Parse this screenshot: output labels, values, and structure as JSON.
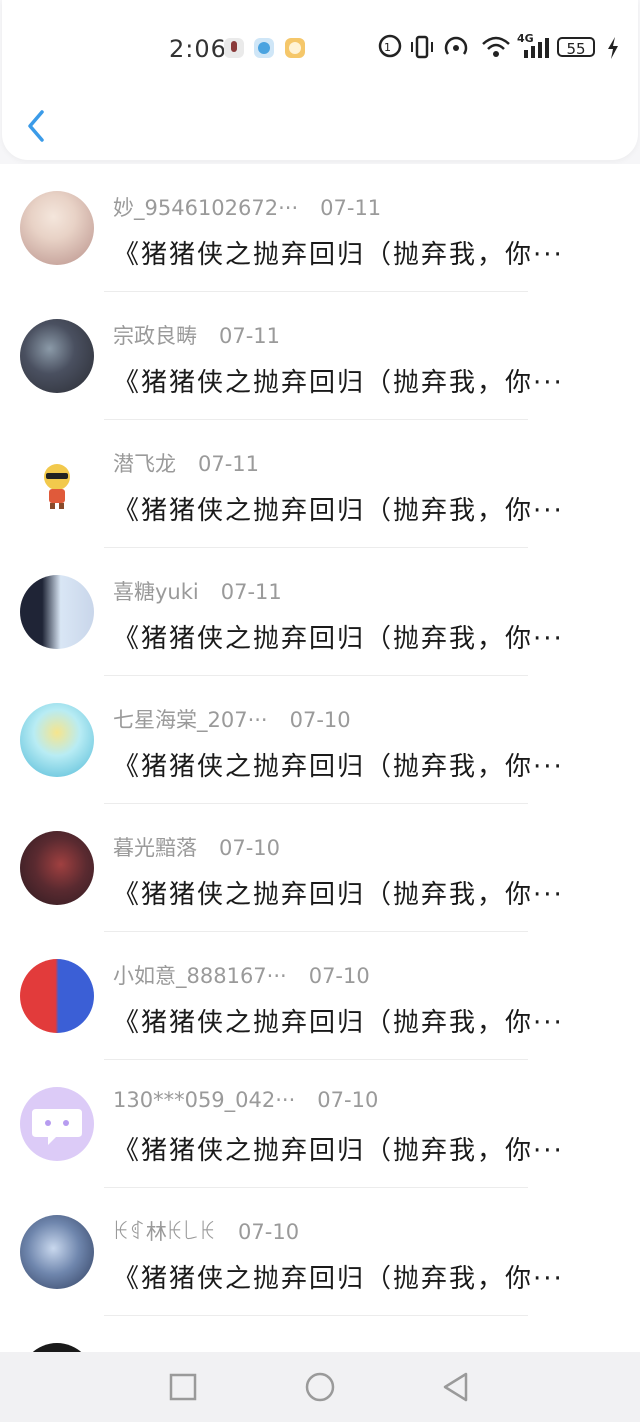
{
  "status_bar": {
    "time": "2:06",
    "signal_label": "4G",
    "battery": "55"
  },
  "comments": [
    {
      "name": "妙_9546102672···",
      "date": "07-11",
      "message": "《猪猪侠之抛弃回归（抛弃我，你···",
      "avatar_colors": [
        "#e8d2c6",
        "#b8908a"
      ]
    },
    {
      "name": "宗政良畴",
      "date": "07-11",
      "message": "《猪猪侠之抛弃回归（抛弃我，你···",
      "avatar_colors": [
        "#2a2c33",
        "#8b9aa8"
      ]
    },
    {
      "name": "潜飞龙",
      "date": "07-11",
      "message": "《猪猪侠之抛弃回归（抛弃我，你···",
      "avatar_colors": [
        "#ffffff",
        "#f2c94c"
      ]
    },
    {
      "name": "喜糖yuki",
      "date": "07-11",
      "message": "《猪猪侠之抛弃回归（抛弃我，你···",
      "avatar_colors": [
        "#1f2436",
        "#d9e6f5"
      ]
    },
    {
      "name": "七星海棠_207···",
      "date": "07-10",
      "message": "《猪猪侠之抛弃回归（抛弃我，你···",
      "avatar_colors": [
        "#7fd6e8",
        "#f6e58d"
      ]
    },
    {
      "name": "暮光黯落",
      "date": "07-10",
      "message": "《猪猪侠之抛弃回归（抛弃我，你···",
      "avatar_colors": [
        "#2b1a20",
        "#8a3030"
      ]
    },
    {
      "name": "小如意_888167···",
      "date": "07-10",
      "message": "《猪猪侠之抛弃回归（抛弃我，你···",
      "avatar_colors": [
        "#e23b3b",
        "#3b5fd6"
      ]
    },
    {
      "name": "130***059_042···",
      "date": "07-10",
      "message": "《猪猪侠之抛弃回归（抛弃我，你···",
      "avatar_colors": [
        "#d9c8f5",
        "#b79cf0"
      ]
    },
    {
      "name": "ꀘꁍ林ꀘ꒒ꀘ",
      "date": "07-10",
      "message": "《猪猪侠之抛弃回归（抛弃我，你···",
      "avatar_colors": [
        "#2c3a5a",
        "#9fb4d8"
      ]
    },
    {
      "name": "",
      "date": "",
      "message": "",
      "avatar_colors": [
        "#1a1a1a",
        "#333333"
      ]
    }
  ]
}
